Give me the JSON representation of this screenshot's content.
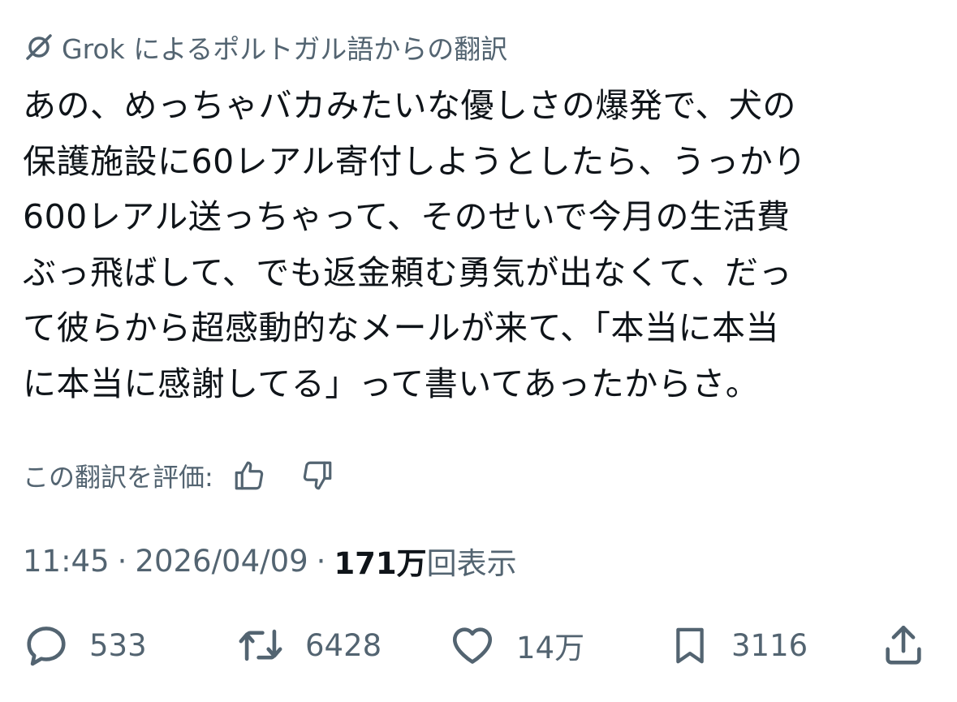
{
  "translation": {
    "label": "Grok によるポルトガル語からの翻訳",
    "icon": "grok-icon"
  },
  "tweet": {
    "lines": [
      "あの、めっちゃバカみたいな優しさの爆発で、犬の",
      "保護施設に60レアル寄付しようとしたら、うっかり",
      "600レアル送っちゃって、そのせいで今月の生活費",
      "ぶっ飛ばして、でも返金頼む勇気が出なくて、だっ",
      "て彼らから超感動的なメールが来て、「本当に本当",
      "に本当に感謝してる」って書いてあったからさ。"
    ]
  },
  "rating": {
    "label": "この翻訳を評価:",
    "up_icon": "thumbs-up-icon",
    "down_icon": "thumbs-down-icon"
  },
  "meta": {
    "time": "11:45",
    "separator": "·",
    "date": "2026/04/09",
    "views_count": "171万",
    "views_label": "回表示"
  },
  "actions": {
    "reply": {
      "icon": "reply-icon",
      "count": "533"
    },
    "retweet": {
      "icon": "retweet-icon",
      "count": "6428"
    },
    "like": {
      "icon": "heart-icon",
      "count": "14万"
    },
    "bookmark": {
      "icon": "bookmark-icon",
      "count": "3116"
    },
    "share": {
      "icon": "share-icon"
    }
  },
  "colors": {
    "text_primary": "#0f1419",
    "text_secondary": "#536471",
    "background": "#ffffff"
  }
}
